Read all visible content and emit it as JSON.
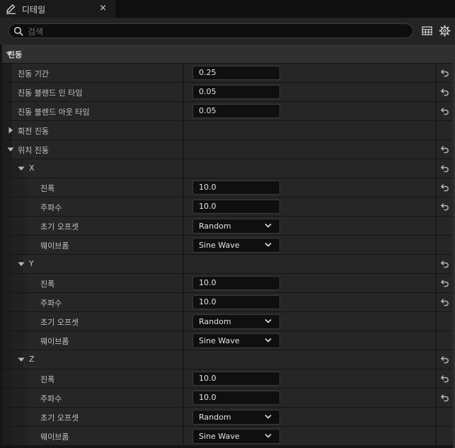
{
  "tab": {
    "title": "디테일",
    "close": "×"
  },
  "search": {
    "placeholder": "검색"
  },
  "toolbar": {
    "table_icon": "table-view-icon",
    "settings_icon": "gear-icon"
  },
  "rows": [
    {
      "type": "category",
      "label": "진동",
      "expanded": true,
      "depth": 0
    },
    {
      "type": "number",
      "label": "진동 기간",
      "value": "0.25",
      "depth": 1,
      "reset": true
    },
    {
      "type": "number",
      "label": "진동 블렌드 인 타임",
      "value": "0.05",
      "depth": 1,
      "reset": true
    },
    {
      "type": "number",
      "label": "진동 블렌드 아웃 타임",
      "value": "0.05",
      "depth": 1,
      "reset": true
    },
    {
      "type": "group",
      "label": "회전 진동",
      "expanded": false,
      "depth": 1,
      "reset": false
    },
    {
      "type": "group",
      "label": "위치 진동",
      "expanded": true,
      "depth": 1,
      "reset": true
    },
    {
      "type": "group",
      "label": "X",
      "expanded": true,
      "depth": 2,
      "reset": true
    },
    {
      "type": "number",
      "label": "진폭",
      "value": "10.0",
      "depth": 3,
      "reset": true
    },
    {
      "type": "number",
      "label": "주파수",
      "value": "10.0",
      "depth": 3,
      "reset": true
    },
    {
      "type": "combo",
      "label": "초기 오프셋",
      "value": "Random",
      "depth": 3,
      "reset": false
    },
    {
      "type": "combo",
      "label": "웨이브폼",
      "value": "Sine Wave",
      "depth": 3,
      "reset": false
    },
    {
      "type": "group",
      "label": "Y",
      "expanded": true,
      "depth": 2,
      "reset": true
    },
    {
      "type": "number",
      "label": "진폭",
      "value": "10.0",
      "depth": 3,
      "reset": true
    },
    {
      "type": "number",
      "label": "주파수",
      "value": "10.0",
      "depth": 3,
      "reset": true
    },
    {
      "type": "combo",
      "label": "초기 오프셋",
      "value": "Random",
      "depth": 3,
      "reset": false
    },
    {
      "type": "combo",
      "label": "웨이브폼",
      "value": "Sine Wave",
      "depth": 3,
      "reset": false
    },
    {
      "type": "group",
      "label": "Z",
      "expanded": true,
      "depth": 2,
      "reset": true
    },
    {
      "type": "number",
      "label": "진폭",
      "value": "10.0",
      "depth": 3,
      "reset": true
    },
    {
      "type": "number",
      "label": "주파수",
      "value": "10.0",
      "depth": 3,
      "reset": true
    },
    {
      "type": "combo",
      "label": "초기 오프셋",
      "value": "Random",
      "depth": 3,
      "reset": false
    },
    {
      "type": "combo",
      "label": "웨이브폼",
      "value": "Sine Wave",
      "depth": 3,
      "reset": false
    }
  ]
}
